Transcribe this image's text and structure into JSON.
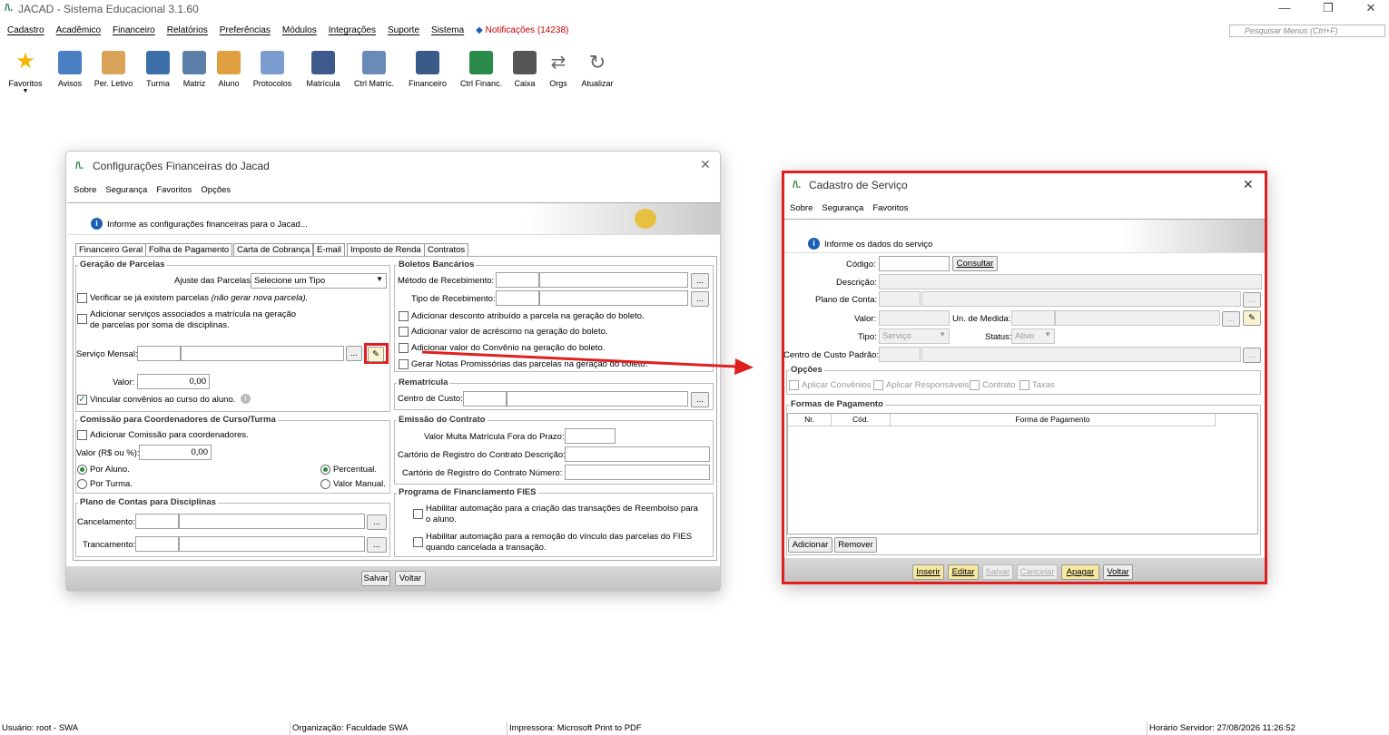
{
  "app": {
    "title": "JACAD - Sistema Educacional 3.1.60",
    "logo": "/\\."
  },
  "menu": [
    "Cadastro",
    "Acadêmico",
    "Financeiro",
    "Relatórios",
    "Preferências",
    "Módulos",
    "Integrações",
    "Suporte",
    "Sistema"
  ],
  "notifications": "Notificações (14238)",
  "search_placeholder": "Pesquisar Menus (Ctrl+F)",
  "toolbar": [
    "Favoritos",
    "Avisos",
    "Per. Letivo",
    "Turma",
    "Matriz",
    "Aluno",
    "Protocolos",
    "Matrícula",
    "Ctrl Matríc.",
    "Financeiro",
    "Ctrl Financ.",
    "Caixa",
    "Orgs",
    "Atualizar"
  ],
  "win1": {
    "title": "Configurações Financeiras do Jacad",
    "menu": [
      "Sobre",
      "Segurança",
      "Favoritos",
      "Opções"
    ],
    "info": "Informe as configurações financeiras para o Jacad...",
    "tabs": [
      "Financeiro Geral",
      "Folha de Pagamento",
      "Carta de Cobrança",
      "E-mail",
      "Imposto de Renda",
      "Contratos"
    ],
    "g1": {
      "title": "Geração de Parcelas",
      "ajuste_label": "Ajuste das Parcelas:",
      "ajuste_value": "Selecione um Tipo",
      "chk1": "Verificar se já existem parcelas",
      "chk1_note": "(não gerar nova parcela).",
      "chk2a": "Adicionar serviços associados a matrícula na geração",
      "chk2b": "de parcelas por soma de disciplinas.",
      "servico": "Serviço Mensal:",
      "valor": "Valor:",
      "valor_v": "0,00",
      "chk3": "Vincular convênios ao curso do aluno."
    },
    "g2": {
      "title": "Boletos Bancários",
      "metodo": "Método de Recebimento:",
      "tipo": "Tipo de Recebimento:",
      "c1": "Adicionar desconto atribuído a parcela na geração do boleto.",
      "c2": "Adicionar valor de acréscimo na geração do boleto.",
      "c3": "Adicionar valor do Convênio na geração do boleto.",
      "c4": "Gerar Notas Promissórias das parcelas na geração do boleto."
    },
    "g3": {
      "title": "Rematrícula",
      "cc": "Centro de Custo:"
    },
    "g4": {
      "title": "Comissão para Coordenadores de Curso/Turma",
      "chk": "Adicionar Comissão para coordenadores.",
      "valor": "Valor (R$ ou %):",
      "valor_v": "0,00",
      "r1": "Por Aluno.",
      "r2": "Por Turma.",
      "r3": "Percentual.",
      "r4": "Valor Manual."
    },
    "g5": {
      "title": "Emissão do Contrato",
      "l1": "Valor Multa Matrícula Fora do Prazo:",
      "l2": "Cartório de Registro do Contrato Descrição:",
      "l3": "Cartório de Registro do Contrato Número:"
    },
    "g6": {
      "title": "Plano de Contas para Disciplinas",
      "l1": "Cancelamento:",
      "l2": "Trancamento:"
    },
    "g7": {
      "title": "Programa de Financiamento FIES",
      "c1a": "Habilitar automação para a criação das transações de Reembolso para",
      "c1b": "o aluno.",
      "c2a": "Habilitar automação para a remoção do vínculo das parcelas do FIES",
      "c2b": "quando cancelada a transação."
    },
    "save": "Salvar",
    "back": "Voltar"
  },
  "win2": {
    "title": "Cadastro de Serviço",
    "menu": [
      "Sobre",
      "Segurança",
      "Favoritos"
    ],
    "info": "Informe os dados do serviço",
    "codigo": "Código:",
    "consultar": "Consultar",
    "descricao": "Descrição:",
    "plano": "Plano de Conta:",
    "valor": "Valor:",
    "unidade": "Un. de Medida:",
    "tipo": "Tipo:",
    "tipo_v": "Serviço",
    "status": "Status:",
    "status_v": "Ativo",
    "centro": "Centro de Custo Padrão:",
    "opcoes": "Opções",
    "op": [
      "Aplicar Convênios",
      "Aplicar Responsáveis",
      "Contrato",
      "Taxas"
    ],
    "formas": "Formas de Pagamento",
    "cols": [
      "Nr.",
      "Cód.",
      "Forma de Pagamento"
    ],
    "adicionar": "Adicionar",
    "remover": "Remover",
    "buttons": [
      "Inserir",
      "Editar",
      "Salvar",
      "Cancelar",
      "Apagar",
      "Voltar"
    ]
  },
  "status": {
    "user": "Usuário: root - SWA",
    "org": "Organização: Faculdade SWA",
    "printer": "Impressora: Microsoft Print to PDF",
    "time": "Horário Servidor: 27/08/2026 11:26:52"
  },
  "colors": {
    "highlight": "#e02020",
    "accent": "#2a7a3a"
  }
}
